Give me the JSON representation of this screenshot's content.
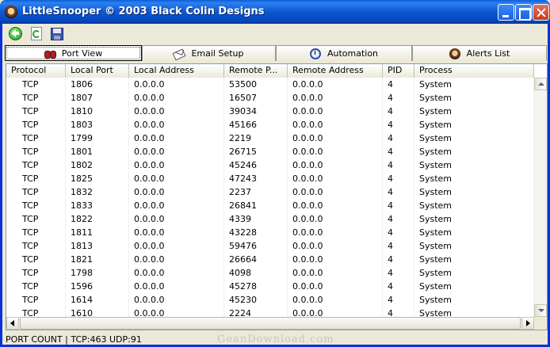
{
  "window": {
    "title": "LittleSnooper © 2003 Black Colin Designs"
  },
  "toolbar": {
    "icons": [
      "back-icon",
      "refresh-icon",
      "save-icon"
    ]
  },
  "tabs": [
    {
      "label": "Port View",
      "icon": "binoculars-icon",
      "active": true
    },
    {
      "label": "Email Setup",
      "icon": "email-icon",
      "active": false
    },
    {
      "label": "Automation",
      "icon": "clock-icon",
      "active": false
    },
    {
      "label": "Alerts List",
      "icon": "alert-icon",
      "active": false
    }
  ],
  "table": {
    "columns": [
      "Protocol",
      "Local Port",
      "Local Address",
      "Remote P...",
      "Remote Address",
      "PID",
      "Process"
    ],
    "rows": [
      [
        "TCP",
        "1806",
        "0.0.0.0",
        "53500",
        "0.0.0.0",
        "4",
        "System"
      ],
      [
        "TCP",
        "1807",
        "0.0.0.0",
        "16507",
        "0.0.0.0",
        "4",
        "System"
      ],
      [
        "TCP",
        "1810",
        "0.0.0.0",
        "39034",
        "0.0.0.0",
        "4",
        "System"
      ],
      [
        "TCP",
        "1803",
        "0.0.0.0",
        "45166",
        "0.0.0.0",
        "4",
        "System"
      ],
      [
        "TCP",
        "1799",
        "0.0.0.0",
        "2219",
        "0.0.0.0",
        "4",
        "System"
      ],
      [
        "TCP",
        "1801",
        "0.0.0.0",
        "26715",
        "0.0.0.0",
        "4",
        "System"
      ],
      [
        "TCP",
        "1802",
        "0.0.0.0",
        "45246",
        "0.0.0.0",
        "4",
        "System"
      ],
      [
        "TCP",
        "1825",
        "0.0.0.0",
        "47243",
        "0.0.0.0",
        "4",
        "System"
      ],
      [
        "TCP",
        "1832",
        "0.0.0.0",
        "2237",
        "0.0.0.0",
        "4",
        "System"
      ],
      [
        "TCP",
        "1833",
        "0.0.0.0",
        "26841",
        "0.0.0.0",
        "4",
        "System"
      ],
      [
        "TCP",
        "1822",
        "0.0.0.0",
        "4339",
        "0.0.0.0",
        "4",
        "System"
      ],
      [
        "TCP",
        "1811",
        "0.0.0.0",
        "43228",
        "0.0.0.0",
        "4",
        "System"
      ],
      [
        "TCP",
        "1813",
        "0.0.0.0",
        "59476",
        "0.0.0.0",
        "4",
        "System"
      ],
      [
        "TCP",
        "1821",
        "0.0.0.0",
        "26664",
        "0.0.0.0",
        "4",
        "System"
      ],
      [
        "TCP",
        "1798",
        "0.0.0.0",
        "4098",
        "0.0.0.0",
        "4",
        "System"
      ],
      [
        "TCP",
        "1596",
        "0.0.0.0",
        "45278",
        "0.0.0.0",
        "4",
        "System"
      ],
      [
        "TCP",
        "1614",
        "0.0.0.0",
        "45230",
        "0.0.0.0",
        "4",
        "System"
      ],
      [
        "TCP",
        "1610",
        "0.0.0.0",
        "2224",
        "0.0.0.0",
        "4",
        "System"
      ]
    ]
  },
  "status": {
    "text": "PORT COUNT | TCP:463 UDP:91"
  },
  "watermark": "GeanDownload.com",
  "colors": {
    "titlebar": "#0b58d2",
    "face": "#ece9d8",
    "list_border": "#7f9db9"
  }
}
